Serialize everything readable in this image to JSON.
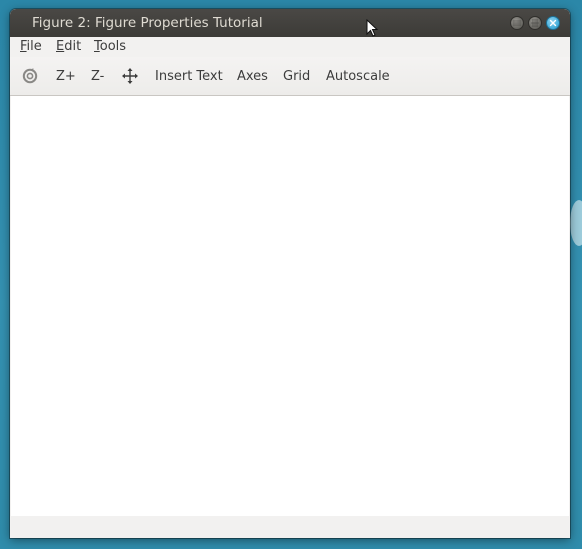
{
  "window": {
    "title": "Figure 2: Figure Properties Tutorial"
  },
  "menubar": {
    "items": [
      {
        "label": "File",
        "mnemonic": "F"
      },
      {
        "label": "Edit",
        "mnemonic": "E"
      },
      {
        "label": "Tools",
        "mnemonic": "T"
      }
    ]
  },
  "toolbar": {
    "reset_icon": "rotate-reset-icon",
    "zoom_in_label": "Z+",
    "zoom_out_label": "Z-",
    "pan_icon": "pan-move-icon",
    "insert_text_label": "Insert Text",
    "axes_label": "Axes",
    "grid_label": "Grid",
    "autoscale_label": "Autoscale"
  },
  "colors": {
    "titlebar": "#3c3b37",
    "close_button": "#4bb2de",
    "desktop": "#2f8dae",
    "canvas": "#ffffff"
  }
}
